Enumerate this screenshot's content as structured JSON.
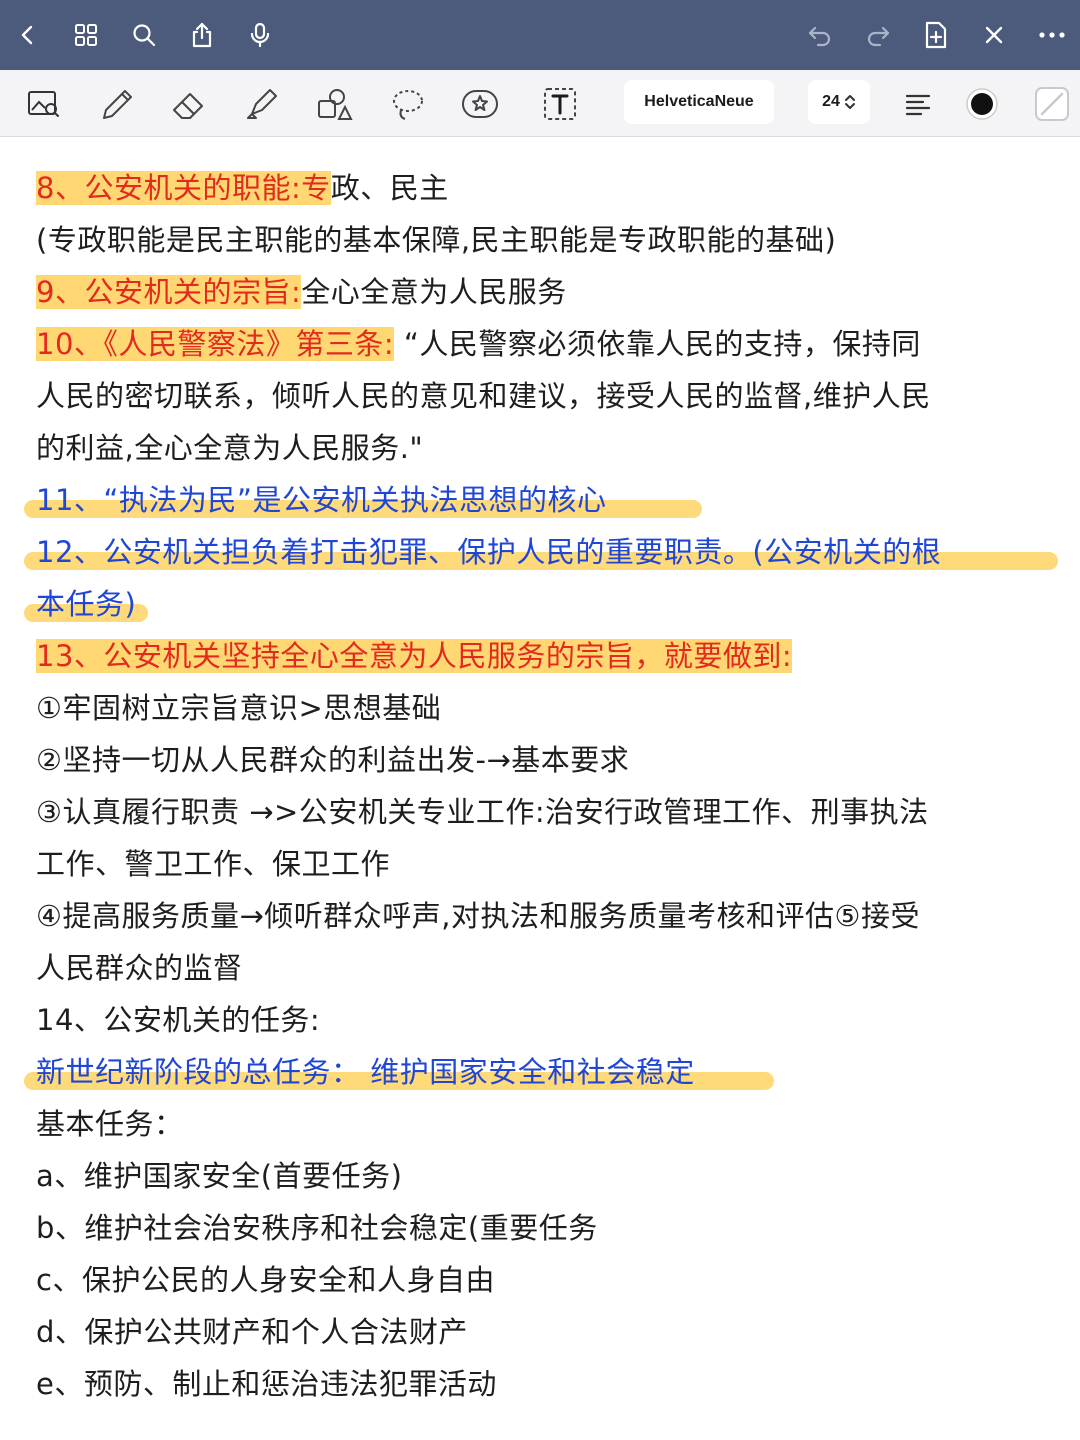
{
  "toolbar": {
    "font_name": "HelveticaNeue",
    "font_size": "24",
    "accent_color": "#4c5a7c",
    "highlight_color": "#ffd874",
    "red_text_color": "#e22a1e",
    "blue_text_color": "#2046d6"
  },
  "icons": {
    "top_left": [
      "back-icon",
      "grid-icon",
      "search-icon",
      "share-icon",
      "microphone-icon"
    ],
    "top_right": [
      "undo-icon",
      "redo-icon",
      "add-page-icon",
      "close-icon",
      "more-icon"
    ],
    "tools": [
      "image-zoom-icon",
      "pen-icon",
      "eraser-icon",
      "highlighter-icon",
      "shapes-icon",
      "lasso-icon",
      "sticker-icon",
      "text-tool-icon",
      "align-icon",
      "color-icon",
      "slash-icon"
    ]
  },
  "note": {
    "l1a": "8、公安机关的职能:专",
    "l1b": "政、民主",
    "l2": "(专政职能是民主职能的基本保障,民主职能是专政职能的基础)",
    "l3a": "9、公安机关的宗旨:",
    "l3b": "全心全意为人民服务",
    "l4a": "10、《人民警察法》第三条:",
    "l4b": " “人民警察必须依靠人民的支持，保持同",
    "l5": "人民的密切联系，倾听人民的意见和建议，接受人民的监督,维护人民",
    "l6": "的利益,全心全意为人民服务.\"",
    "l7": "11、“执法为民”是公安机关执法思想的核心",
    "l8": "12、公安机关担负着打击犯罪、保护人民的重要职责。(公安机关的根",
    "l9": "本任务)",
    "l10": "13、公安机关坚持全心全意为人民服务的宗旨，就要做到:",
    "l11": "①牢固树立宗旨意识>思想基础",
    "l12": "②坚持一切从人民群众的利益出发-→基本要求",
    "l13": "③认真履行职责 →>公安机关专业工作:治安行政管理工作、刑事执法",
    "l14": "工作、警卫工作、保卫工作",
    "l15": "④提高服务质量→倾听群众呼声,对执法和服务质量考核和评估⑤接受",
    "l16": "人民群众的监督",
    "l17": "14、公安机关的任务:",
    "l18": "新世纪新阶段的总任务：  维护国家安全和社会稳定",
    "l19": "基本任务：",
    "l20": "a、维护国家安全(首要任务)",
    "l21": "b、维护社会治安秩序和社会稳定(重要任务",
    "l22": "c、保护公民的人身安全和人身自由",
    "l23": "d、保护公共财产和个人合法财产",
    "l24": " e、预防、制止和惩治违法犯罪活动"
  }
}
